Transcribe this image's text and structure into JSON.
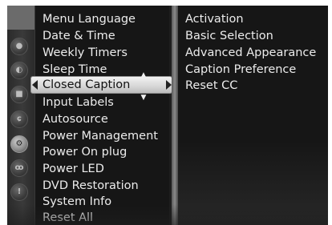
{
  "side_icons": [
    {
      "name": "picture-icon",
      "glyph": "●"
    },
    {
      "name": "audio-icon",
      "glyph": "◐"
    },
    {
      "name": "timer-icon",
      "glyph": "■"
    },
    {
      "name": "lock-icon",
      "glyph": "ɕ"
    },
    {
      "name": "setup-icon",
      "glyph": "⚙"
    },
    {
      "name": "network-icon",
      "glyph": "ꝏ"
    },
    {
      "name": "info-icon",
      "glyph": "!"
    }
  ],
  "menu": {
    "items": [
      {
        "label": "Menu Language"
      },
      {
        "label": "Date & Time"
      },
      {
        "label": "Weekly Timers"
      },
      {
        "label": "Sleep Time"
      },
      {
        "label": "Closed Caption"
      },
      {
        "label": "Input Labels"
      },
      {
        "label": "Autosource"
      },
      {
        "label": "Power Management"
      },
      {
        "label": "Power On plug"
      },
      {
        "label": "Power LED"
      },
      {
        "label": "DVD Restoration"
      },
      {
        "label": "System Info"
      },
      {
        "label": "Reset All"
      }
    ],
    "selected_index": 4,
    "up_glyph": "▲",
    "down_glyph": "▼"
  },
  "submenu": {
    "items": [
      {
        "label": "Activation"
      },
      {
        "label": "Basic Selection"
      },
      {
        "label": "Advanced Appearance"
      },
      {
        "label": "Caption Preference"
      },
      {
        "label": "Reset CC"
      }
    ]
  },
  "colors": {
    "panel_bg": "#161616",
    "text": "#ececec",
    "highlight": "#d6d6d6",
    "selected_text": "#111111"
  }
}
